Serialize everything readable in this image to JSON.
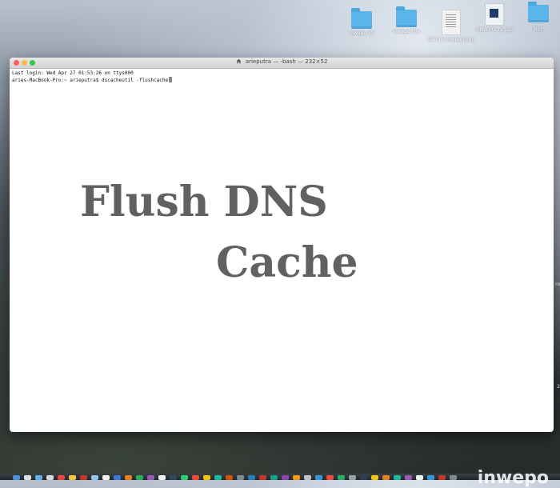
{
  "desktop": {
    "icons": [
      {
        "label": "Inwepo SS",
        "kind": "folder-icon"
      },
      {
        "label": "Inwepo File",
        "kind": "folder-icon"
      },
      {
        "label": "Banner inwepo.png",
        "kind": "image-file-icon"
      },
      {
        "label": "INWEPO TV.psd",
        "kind": "psd-file-icon"
      },
      {
        "label": "Pict",
        "kind": "folder-icon"
      }
    ],
    "edge_text_1": "ro",
    "edge_text_2": "2"
  },
  "terminal": {
    "title": "arieputra — -bash — 232×52",
    "lines": [
      "Last login: Wed Apr 27 01:53:26 on ttys000",
      "aries-MacBook-Pro:~ arieputra$ dscacheutil -flushcache"
    ]
  },
  "overlay": {
    "line1": "Flush DNS",
    "line2": "Cache",
    "color": "#616161"
  },
  "watermark": "inwepo",
  "colors": {
    "folder": "#5ab5ea",
    "close": "#fc605c",
    "minimize": "#fdbc40",
    "zoom": "#34c84a"
  }
}
